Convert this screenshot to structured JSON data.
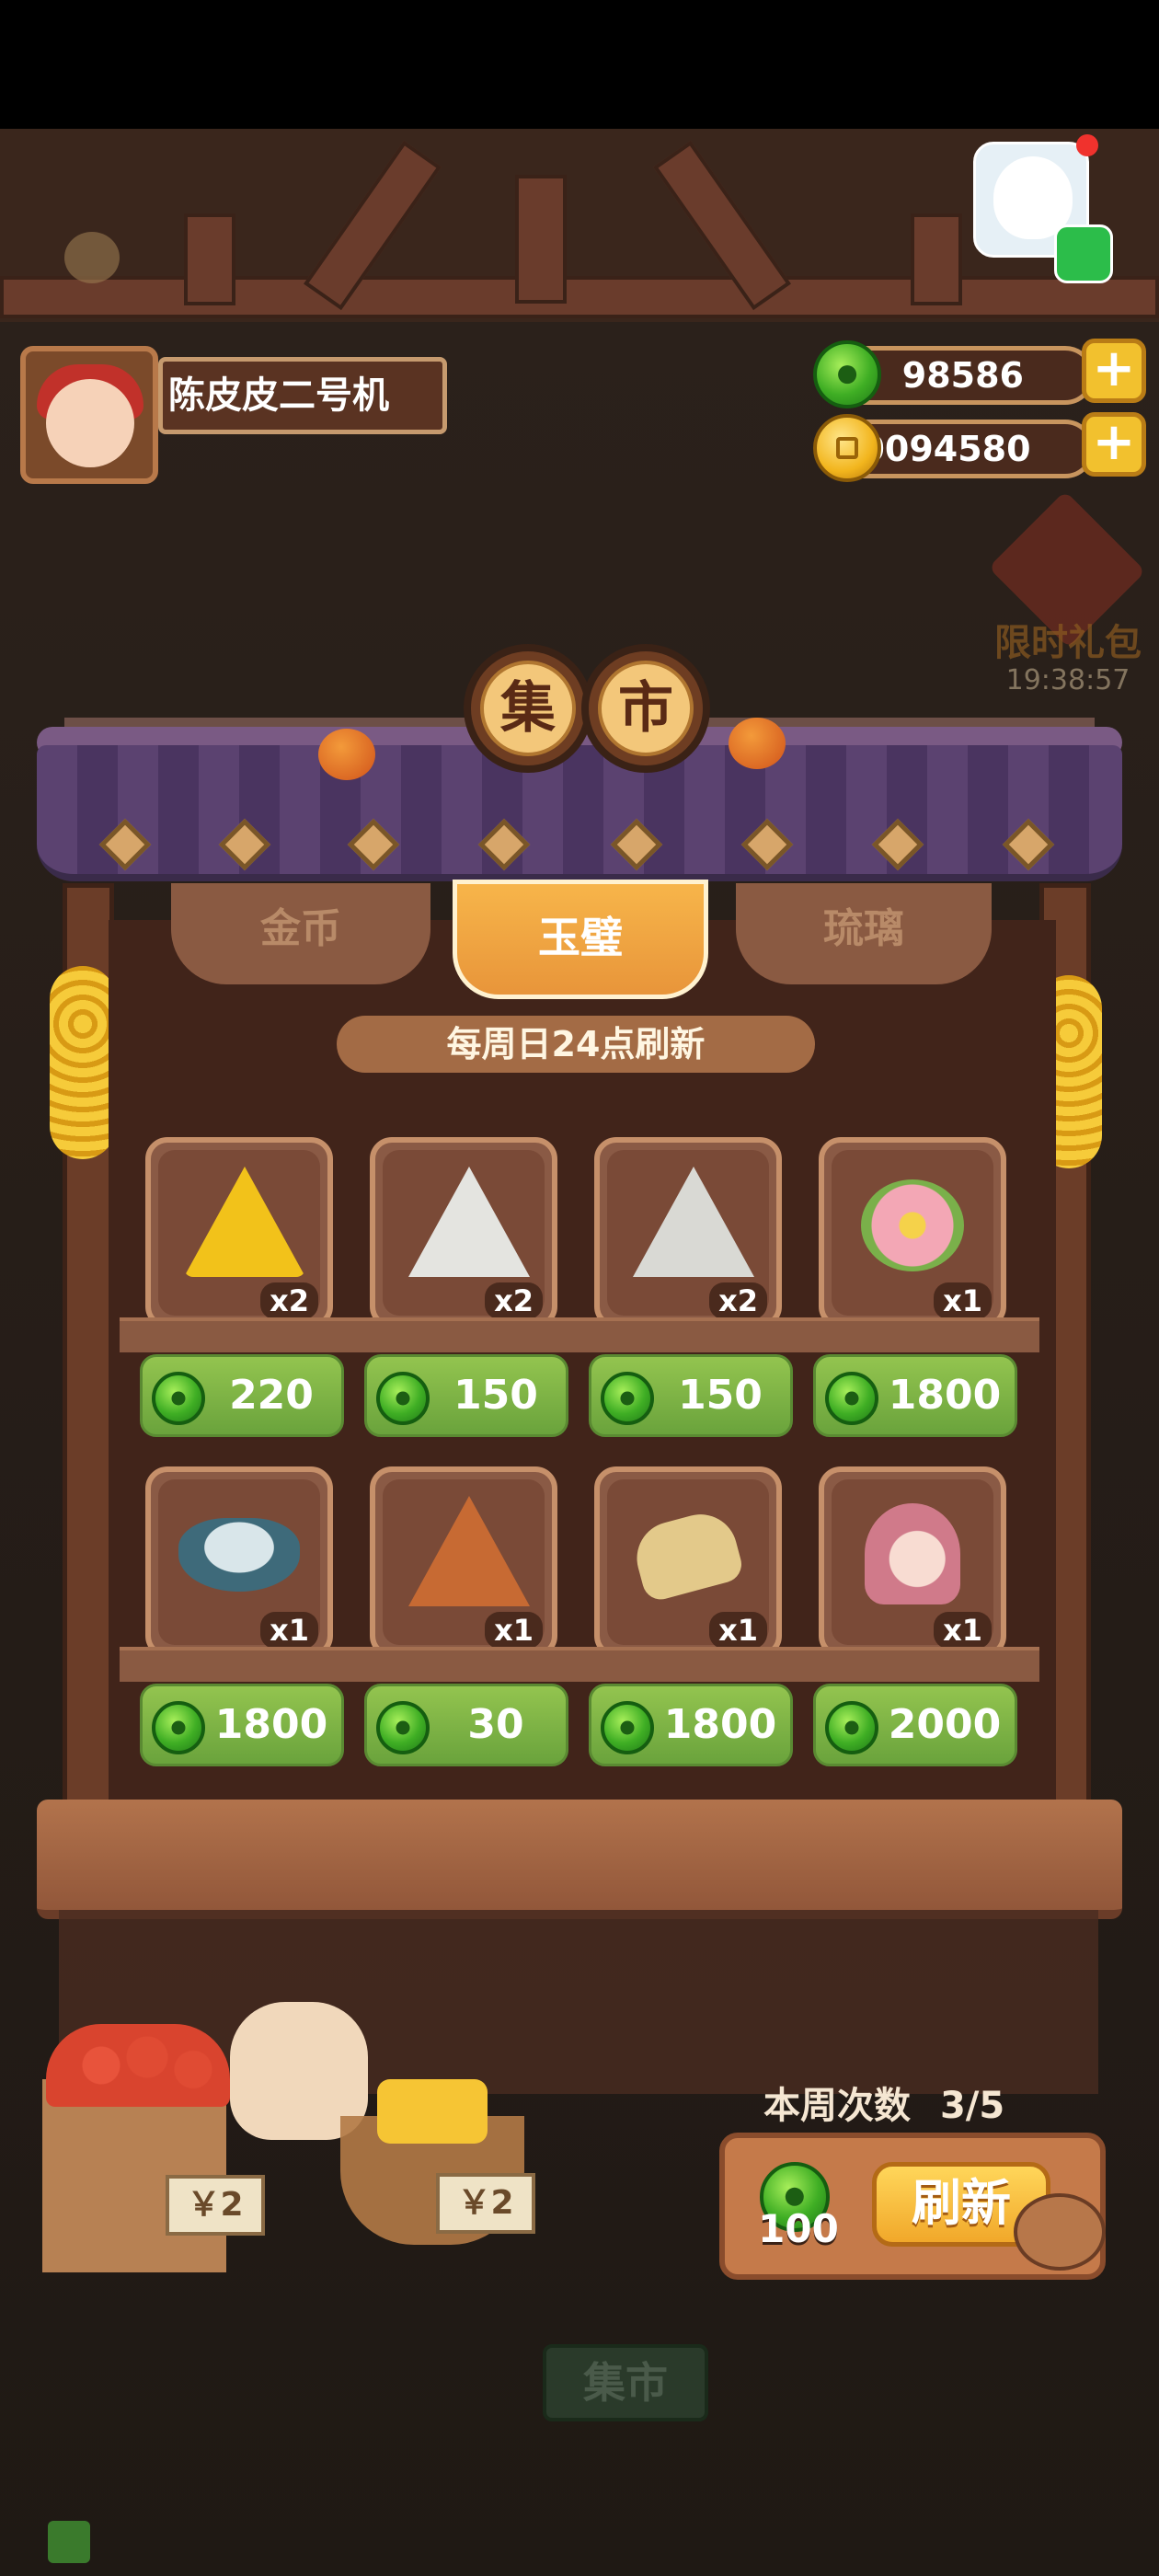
{
  "player": {
    "name": "陈皮皮二号机"
  },
  "currencies": {
    "jade": {
      "icon": "jade-coin-icon",
      "value": "98586"
    },
    "gold": {
      "icon": "gold-coin-icon",
      "value": "20094580"
    }
  },
  "gift": {
    "label": "限时礼包",
    "timer": "19:38:57"
  },
  "title": {
    "char1": "集",
    "char2": "市"
  },
  "tabs": [
    {
      "label": "金币",
      "active": false
    },
    {
      "label": "玉璧",
      "active": true
    },
    {
      "label": "琉璃",
      "active": false
    }
  ],
  "notice": "每周日24点刷新",
  "items": [
    {
      "icon": "gold-star-rice-dumpling-icon",
      "qty": "x2",
      "price": "220"
    },
    {
      "icon": "white-swirl-rice-dumpling-icon",
      "qty": "x2",
      "price": "150"
    },
    {
      "icon": "silver-leaf-rice-dumpling-icon",
      "qty": "x2",
      "price": "150"
    },
    {
      "icon": "pink-flower-ornament-icon",
      "qty": "x1",
      "price": "1800"
    },
    {
      "icon": "porcelain-bowl-icon",
      "qty": "x1",
      "price": "1800"
    },
    {
      "icon": "brown-flower-rice-dumpling-icon",
      "qty": "x1",
      "price": "30"
    },
    {
      "icon": "embroidered-shoes-icon",
      "qty": "x1",
      "price": "1800"
    },
    {
      "icon": "pink-hair-character-icon",
      "qty": "x1",
      "price": "2000"
    }
  ],
  "refresh": {
    "week_count_label": "本周次数",
    "week_count": "3/5",
    "cost": "100",
    "button_label": "刷新"
  },
  "stall_signs": [
    "￥2",
    "￥2"
  ],
  "bottom_nav": {
    "market_label": "集市"
  },
  "colors": {
    "jade": "#4fb52a",
    "gold": "#f2b51d",
    "tab_active": "#f0a03e",
    "price_bg": "#7fb447"
  }
}
